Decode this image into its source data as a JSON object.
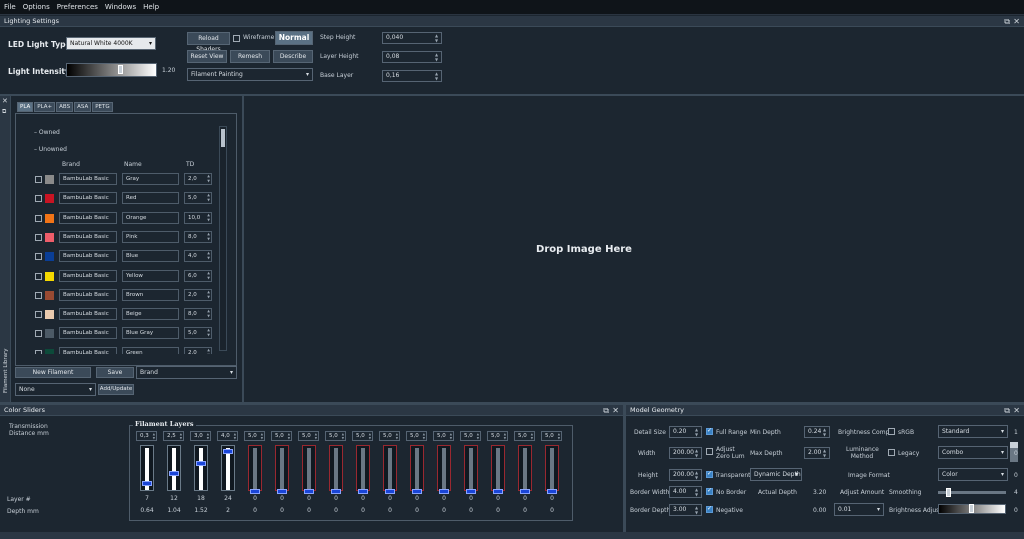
{
  "menu": [
    "File",
    "Options",
    "Preferences",
    "Windows",
    "Help"
  ],
  "lighting": {
    "title": "Lighting Settings",
    "led_label": "LED Light Type",
    "led_value": "Natural White 4000K",
    "intensity_label": "Light Intensity",
    "intensity_value": "1.20",
    "intensity": 0.6,
    "reload": "Reload Shaders",
    "wireframe": "Wireframe",
    "normal": "Normal",
    "reset_view": "Reset View",
    "remesh": "Remesh",
    "describe": "Describe",
    "mode": "Filament Painting",
    "step_label": "Step Height",
    "step_value": "0,040",
    "layer_label": "Layer Height",
    "layer_value": "0,08",
    "base_label": "Base Layer",
    "base_value": "0,16"
  },
  "library": {
    "side_title": "Filament Library",
    "tabs": [
      "PLA",
      "PLA+",
      "ABS",
      "ASA",
      "PETG"
    ],
    "owned": "– Owned",
    "unowned": "– Unowned",
    "headers": {
      "brand": "Brand",
      "name": "Name",
      "td": "TD"
    },
    "rows": [
      {
        "brand": "BambuLab Basic",
        "name": "Gray",
        "td": "2,0",
        "color": "#8a8a8a"
      },
      {
        "brand": "BambuLab Basic",
        "name": "Red",
        "td": "5,0",
        "color": "#c81423"
      },
      {
        "brand": "BambuLab Basic",
        "name": "Orange",
        "td": "10,0",
        "color": "#f27417"
      },
      {
        "brand": "BambuLab Basic",
        "name": "Pink",
        "td": "8,0",
        "color": "#ee5d6a"
      },
      {
        "brand": "BambuLab Basic",
        "name": "Blue",
        "td": "4,0",
        "color": "#0a3e96"
      },
      {
        "brand": "BambuLab Basic",
        "name": "Yellow",
        "td": "6,0",
        "color": "#f5d800"
      },
      {
        "brand": "BambuLab Basic",
        "name": "Brown",
        "td": "2,0",
        "color": "#994a32"
      },
      {
        "brand": "BambuLab Basic",
        "name": "Beige",
        "td": "8,0",
        "color": "#e9c9ad"
      },
      {
        "brand": "BambuLab Basic",
        "name": "Blue Gray",
        "td": "5,0",
        "color": "#4c5a66"
      },
      {
        "brand": "BambuLab Basic",
        "name": "Green",
        "td": "2,0",
        "color": "#0d4a3a"
      }
    ],
    "new_filament": "New Filament",
    "save": "Save",
    "brand_combo": "Brand",
    "none_combo": "None",
    "add_update": "Add/Update"
  },
  "viewport": {
    "drop": "Drop Image Here"
  },
  "color_sliders": {
    "title": "Color Sliders",
    "transmission": "Transmission",
    "distance": "Distance mm",
    "group": "Filament Layers",
    "layer_label": "Layer #",
    "depth_label": "Depth mm",
    "values": [
      "0,3",
      "2,5",
      "3,0",
      "4,0",
      "5,0",
      "5,0",
      "5,0",
      "5,0",
      "5,0",
      "5,0",
      "5,0",
      "5,0",
      "5,0",
      "5,0",
      "5,0",
      "5,0"
    ],
    "layers": [
      "7",
      "12",
      "18",
      "24",
      "0",
      "0",
      "0",
      "0",
      "0",
      "0",
      "0",
      "0",
      "0",
      "0",
      "0",
      "0"
    ],
    "depths": [
      "0.64",
      "1.04",
      "1.52",
      "2",
      "0",
      "0",
      "0",
      "0",
      "0",
      "0",
      "0",
      "0",
      "0",
      "0",
      "0",
      "0"
    ],
    "levels": [
      0.2,
      0.45,
      0.7,
      1.0,
      0,
      0,
      0,
      0,
      0,
      0,
      0,
      0,
      0,
      0,
      0,
      0
    ]
  },
  "model": {
    "title": "Model Geometry",
    "detail_label": "Detail Size",
    "detail_value": "0.20",
    "full_range": "Full Range",
    "min_depth_label": "Min Depth",
    "min_depth_value": "0.24",
    "brightness_comp": "Brightness Comp",
    "srgb": "sRGB",
    "standard": "Standard",
    "one": "1",
    "width_label": "Width",
    "width_value": "200.00",
    "adjust_zero": "Adjust Zero Lum",
    "max_depth_label": "Max Depth",
    "max_depth_value": "2.00",
    "luminance": "Luminance Method",
    "legacy": "Legacy",
    "combo": "Combo",
    "zero": "0",
    "height_label": "Height",
    "height_value": "200.00",
    "transparent": "Transparent",
    "dynamic_depth": "Dynamic Depth",
    "image_format": "Image Format",
    "color": "Color",
    "zero2": "0",
    "border_width_label": "Border Width",
    "border_width_value": "4.00",
    "no_border": "No Border",
    "actual_depth_label": "Actual Depth",
    "actual_depth_value": "3.20",
    "adjust_amount": "Adjust Amount",
    "smoothing": "Smoothing",
    "smoothing_value": "4",
    "border_depth_label": "Border Depth",
    "border_depth_value": "3.00",
    "negative": "Negative",
    "zero_val": "0.00",
    "combo_001": "0.01",
    "brightness_adjust": "Brightness Adjust",
    "brightness_value": "0"
  }
}
